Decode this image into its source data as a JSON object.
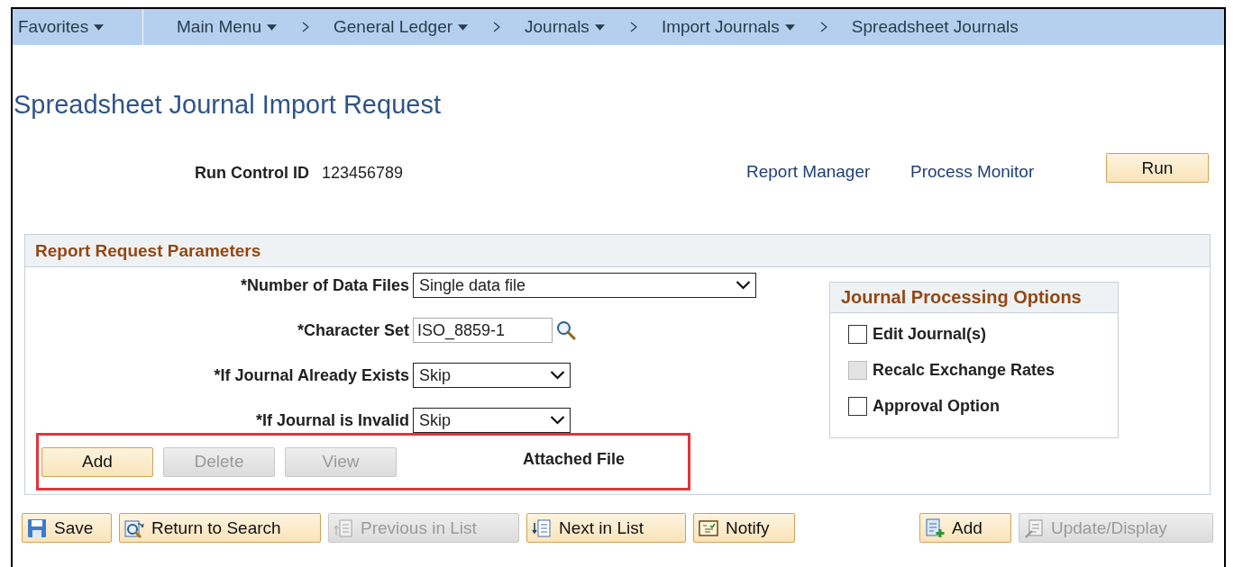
{
  "favorites": {
    "label": "Favorites",
    "dropdown": true
  },
  "breadcrumbs": [
    {
      "label": "Main Menu",
      "dropdown": true
    },
    {
      "label": "General Ledger",
      "dropdown": true
    },
    {
      "label": "Journals",
      "dropdown": true
    },
    {
      "label": "Import Journals",
      "dropdown": true
    },
    {
      "label": "Spreadsheet Journals",
      "dropdown": false
    }
  ],
  "title": "Spreadsheet Journal Import Request",
  "run_control": {
    "label": "Run Control ID",
    "value": "123456789"
  },
  "links": [
    "Report Manager",
    "Process Monitor"
  ],
  "run_button": "Run",
  "parameters": {
    "title": "Report Request Parameters",
    "fields": [
      {
        "kind": "select",
        "label": "*Number of Data Files",
        "value": "Single data file"
      },
      {
        "kind": "lookup",
        "label": "*Character Set",
        "value": "ISO_8859-1"
      },
      {
        "kind": "select",
        "label": "*If Journal Already Exists",
        "value": "Skip"
      },
      {
        "kind": "select",
        "label": "*If Journal is Invalid",
        "value": "Skip"
      }
    ],
    "options": {
      "title": "Journal Processing Options",
      "items": [
        {
          "label": "Edit Journal(s)",
          "checked": false,
          "disabled": false
        },
        {
          "label": "Recalc Exchange Rates",
          "checked": false,
          "disabled": true
        },
        {
          "label": "Approval Option",
          "checked": false,
          "disabled": false
        }
      ]
    },
    "attachments": {
      "highlighted": true,
      "buttons": [
        {
          "label": "Add",
          "disabled": false
        },
        {
          "label": "Delete",
          "disabled": true
        },
        {
          "label": "View",
          "disabled": true
        }
      ],
      "label": "Attached File"
    }
  },
  "toolbar_left": [
    {
      "kind": "save",
      "label": "Save",
      "disabled": false
    },
    {
      "kind": "return",
      "label": "Return to Search",
      "disabled": false
    },
    {
      "kind": "previous",
      "label": "Previous in List",
      "disabled": true
    },
    {
      "kind": "next",
      "label": "Next in List",
      "disabled": false
    },
    {
      "kind": "notify",
      "label": "Notify",
      "disabled": false
    }
  ],
  "toolbar_right": [
    {
      "kind": "add",
      "label": "Add",
      "disabled": false
    },
    {
      "kind": "update",
      "label": "Update/Display",
      "disabled": true
    }
  ]
}
